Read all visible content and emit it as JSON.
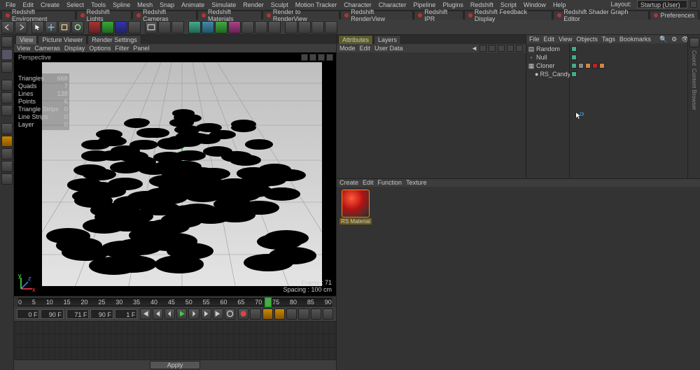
{
  "menus": [
    "File",
    "Edit",
    "Create",
    "Select",
    "Tools",
    "Spline",
    "Mesh",
    "Snap",
    "Animate",
    "Simulate",
    "Render",
    "Sculpt",
    "Motion Tracker",
    "Character",
    "Character",
    "Pipeline",
    "Plugins",
    "Redshift",
    "Script",
    "Window",
    "Help"
  ],
  "layout_label": "Layout:",
  "layout_value": "Startup (User)",
  "top_tabs": [
    {
      "label": "Redshift Environment"
    },
    {
      "label": "Redshift Lights"
    },
    {
      "label": "Redshift Cameras"
    },
    {
      "label": "Redshift Materials"
    },
    {
      "label": "Render to RenderView"
    },
    {
      "label": "Redshift RenderView"
    },
    {
      "label": "Redshift IPR"
    },
    {
      "label": "Redshift Feedback Display"
    },
    {
      "label": "Redshift Shader Graph Editor"
    },
    {
      "label": "Preferences"
    }
  ],
  "view_tabs": [
    "View",
    "Picture Viewer",
    "Render Settings"
  ],
  "view_menu": [
    "View",
    "Cameras",
    "Display",
    "Options",
    "Filter",
    "Panel"
  ],
  "viewport": {
    "label": "Perspective",
    "frame_label": "Frame : 71",
    "spacing_label": "Spacing : 100 cm",
    "stats": [
      {
        "k": "Triangles",
        "v": "668"
      },
      {
        "k": "Quads",
        "v": "7"
      },
      {
        "k": "Lines",
        "v": "138"
      },
      {
        "k": "Points",
        "v": "6"
      },
      {
        "k": "Triangle Strips",
        "v": "0"
      },
      {
        "k": "Line Strips",
        "v": "0"
      },
      {
        "k": "Layer",
        "v": "0"
      }
    ]
  },
  "timeline": {
    "start": 0,
    "end": 90,
    "ticks": [
      "0",
      "5",
      "10",
      "15",
      "20",
      "25",
      "30",
      "35",
      "40",
      "45",
      "50",
      "55",
      "60",
      "65",
      "70",
      "75",
      "80",
      "85",
      "90"
    ],
    "playhead": 71,
    "field_start": "0 F",
    "field_end": "90 F",
    "field_cur": "71 F",
    "field_last": "90 F",
    "field_step": "1 F"
  },
  "apply_label": "Apply",
  "attr_panel": {
    "tabs": [
      "Attributes",
      "Layers"
    ],
    "menu": [
      "Mode",
      "Edit",
      "User Data"
    ],
    "icon_arrow": "◄"
  },
  "obj_panel": {
    "menu": [
      "File",
      "Edit",
      "View",
      "Objects",
      "Tags",
      "Bookmarks"
    ],
    "tree": [
      {
        "label": "Random",
        "icon": "rand"
      },
      {
        "label": "Null",
        "icon": "null"
      },
      {
        "label": "Cloner",
        "icon": "cloner",
        "children": [
          {
            "label": "RS_Candy",
            "icon": "sphere"
          }
        ]
      }
    ]
  },
  "mat_panel": {
    "menu": [
      "Create",
      "Edit",
      "Function",
      "Texture"
    ],
    "material_name": "RS Material"
  },
  "right_strip": [
    "Coord",
    "Content Browser"
  ]
}
